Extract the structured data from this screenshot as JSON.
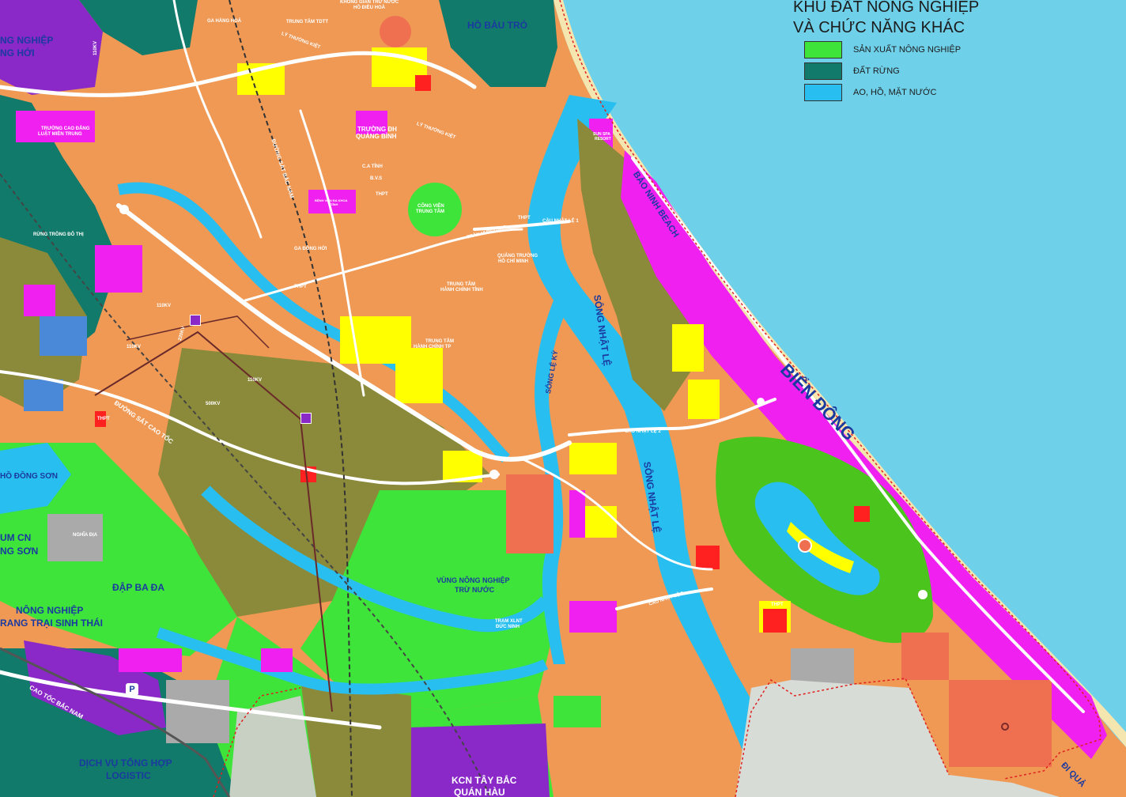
{
  "legend": {
    "title_line1": "KHU ĐẤT NÔNG NGHIỆP",
    "title_line2": "VÀ CHỨC NĂNG KHÁC",
    "items": [
      {
        "label": "SẢN XUẤT NÔNG NGHIỆP",
        "color": "#3ee43a"
      },
      {
        "label": "ĐẤT RỪNG",
        "color": "#127a6a"
      },
      {
        "label": "AO, HỒ, MẶT NƯỚC",
        "color": "#28bff0"
      }
    ]
  },
  "colors": {
    "sea": "#6fd0ea",
    "residential": "#ef9955",
    "mixed_use": "#f020f0",
    "agriculture": "#3ee43a",
    "forest": "#127a6a",
    "water": "#28bff0",
    "olive_green": "#8a8a3a",
    "yellow_public": "#ffff00",
    "industrial": "#8a28c8",
    "road": "#ffffff",
    "boundary": "#e02020"
  },
  "labels": {
    "bien_dong": "BIỂN ĐÔNG",
    "bao_ninh_beach": "BẢO NINH BEACH",
    "song_nhat_le_1": "SÔNG NHẬT LỆ",
    "song_nhat_le_2": "SÔNG NHẬT LỆ",
    "song_le_ky": "SÔNG LỆ KỲ",
    "ho_bau_tro": "HỒ BÀU TRÓ",
    "nghiep_hoi_1": "NG NGHIỆP",
    "nghiep_hoi_2": "NG HỚI",
    "ho_dong_son": "HỒ ĐỒNG SƠN",
    "cum_cn_1": "UM CN",
    "cum_cn_2": "NG SƠN",
    "dap_ba_da": "ĐẬP BA ĐA",
    "nong_nghiep_1": "NÔNG NGHIỆP",
    "nong_nghiep_2": "RANG TRẠI SINH THÁI",
    "dich_vu_1": "DỊCH VỤ TỔNG HỢP",
    "dich_vu_2": "LOGISTIC",
    "vung_nong_nghiep_1": "VÙNG NÔNG NGHIỆP",
    "vung_nong_nghiep_2": "TRỪ NƯỚC",
    "kcn_1": "KCN TÂY BẮC",
    "kcn_2": "QUÁN HÀU",
    "di_quang": "ĐI QUẢ",
    "cao_toc_bac_nam": "CAO TỐC BẮC NAM",
    "duong_sat_cao_toc": "ĐƯỜNG SẮT CAO TỐC",
    "duong_sat_bac_nam": "ĐƯỜNG SẮT BẮC NAM",
    "cau_nhat_le_1": "CẦU NHẬT LỆ 1",
    "cau_nhat_le_2": "CẦU NHẬT LỆ 2",
    "cau_nhat_le_3": "CẦU NHẬT LỆ 3",
    "ly_thuong_kiet_1": "LÝ THƯỜNG KIỆT",
    "ly_thuong_kiet_2": "LÝ THƯỜNG KIỆT",
    "tran_hung_dao": "TRẦN HƯNG ĐẠO",
    "ga_dong_hoi": "GA ĐỒNG HỚI",
    "ga_hang_hoa": "GA HÀNG HOÁ",
    "trung_tam_tdtt": "TRUNG TÂM TDTT",
    "khong_gian_1": "KHÔNG GIAN TRỮ NƯỚC",
    "khong_gian_2": "HỒ ĐIỀU HOÀ",
    "truong_cao_dang_1": "TRƯỜNG CAO ĐẲNG",
    "truong_cao_dang_2": "LUẬT MIỀN TRUNG",
    "truong_dh_1": "TRƯỜNG ĐH",
    "truong_dh_2": "QUẢNG BÌNH",
    "ca_tinh": "C.A TỈNH",
    "bvs": "B.V.S",
    "benh_vien_1": "BỆNH VIỆN ĐA KHOA",
    "benh_vien_2": "TỈNH",
    "thpt_1": "THPT",
    "thpt_2": "THPT",
    "thpt_3": "THPT",
    "thpt_4": "THPT",
    "thpt_5": "THPT",
    "cong_vien_1": "CÔNG VIÊN",
    "cong_vien_2": "TRUNG TÂM",
    "quang_truong_1": "QUẢNG TRƯỜNG",
    "quang_truong_2": "HỒ CHÍ MINH",
    "tt_hanh_chinh_tinh_1": "TRUNG TÂM",
    "tt_hanh_chinh_tinh_2": "HÀNH CHÍNH TỈNH",
    "tt_hanh_chinh_tp_1": "TRUNG TÂM",
    "tt_hanh_chinh_tp_2": "HÀNH CHÍNH TP",
    "rung_trong": "RỪNG TRỒNG ĐÔ THỊ",
    "sun_spa_1": "SUN SPA",
    "sun_spa_2": "RESORT",
    "nghia_dia": "NGHĨA ĐỊA",
    "tram_xlnt_1": "TRẠM XLNT",
    "tram_xlnt_2": "ĐỨC NINH",
    "kv_110_1": "110KV",
    "kv_110_2": "110KV",
    "kv_110_3": "110KV",
    "kv_110_4": "110KV",
    "kv_500": "500KV",
    "kv_220": "220KV"
  }
}
